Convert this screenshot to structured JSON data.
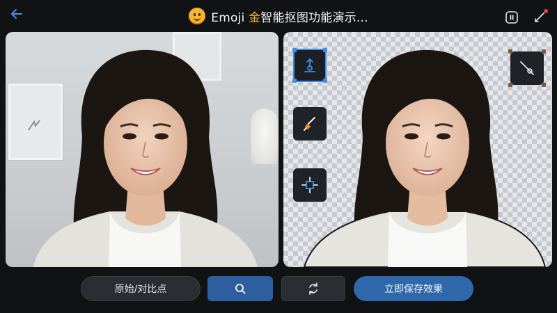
{
  "header": {
    "title_prefix": "Emoji ",
    "title_gold": "金",
    "title_rest": "智能抠图功能演示..."
  },
  "icons": {
    "back": "back-arrow-icon",
    "pause": "pause-icon",
    "edit": "edit-pen-icon",
    "upload": "upload-icon",
    "brush": "brush-icon",
    "fit": "fit-to-frame-icon",
    "eraser": "eraser-line-icon",
    "search": "search-icon",
    "swap": "swap-icon"
  },
  "bottom_bar": {
    "original_label": "原始/对比点",
    "save_label": "立即保存效果"
  },
  "colors": {
    "accent": "#3b8ee8",
    "gold": "#f2b233",
    "background": "#101214",
    "notify": "#e8413a"
  }
}
